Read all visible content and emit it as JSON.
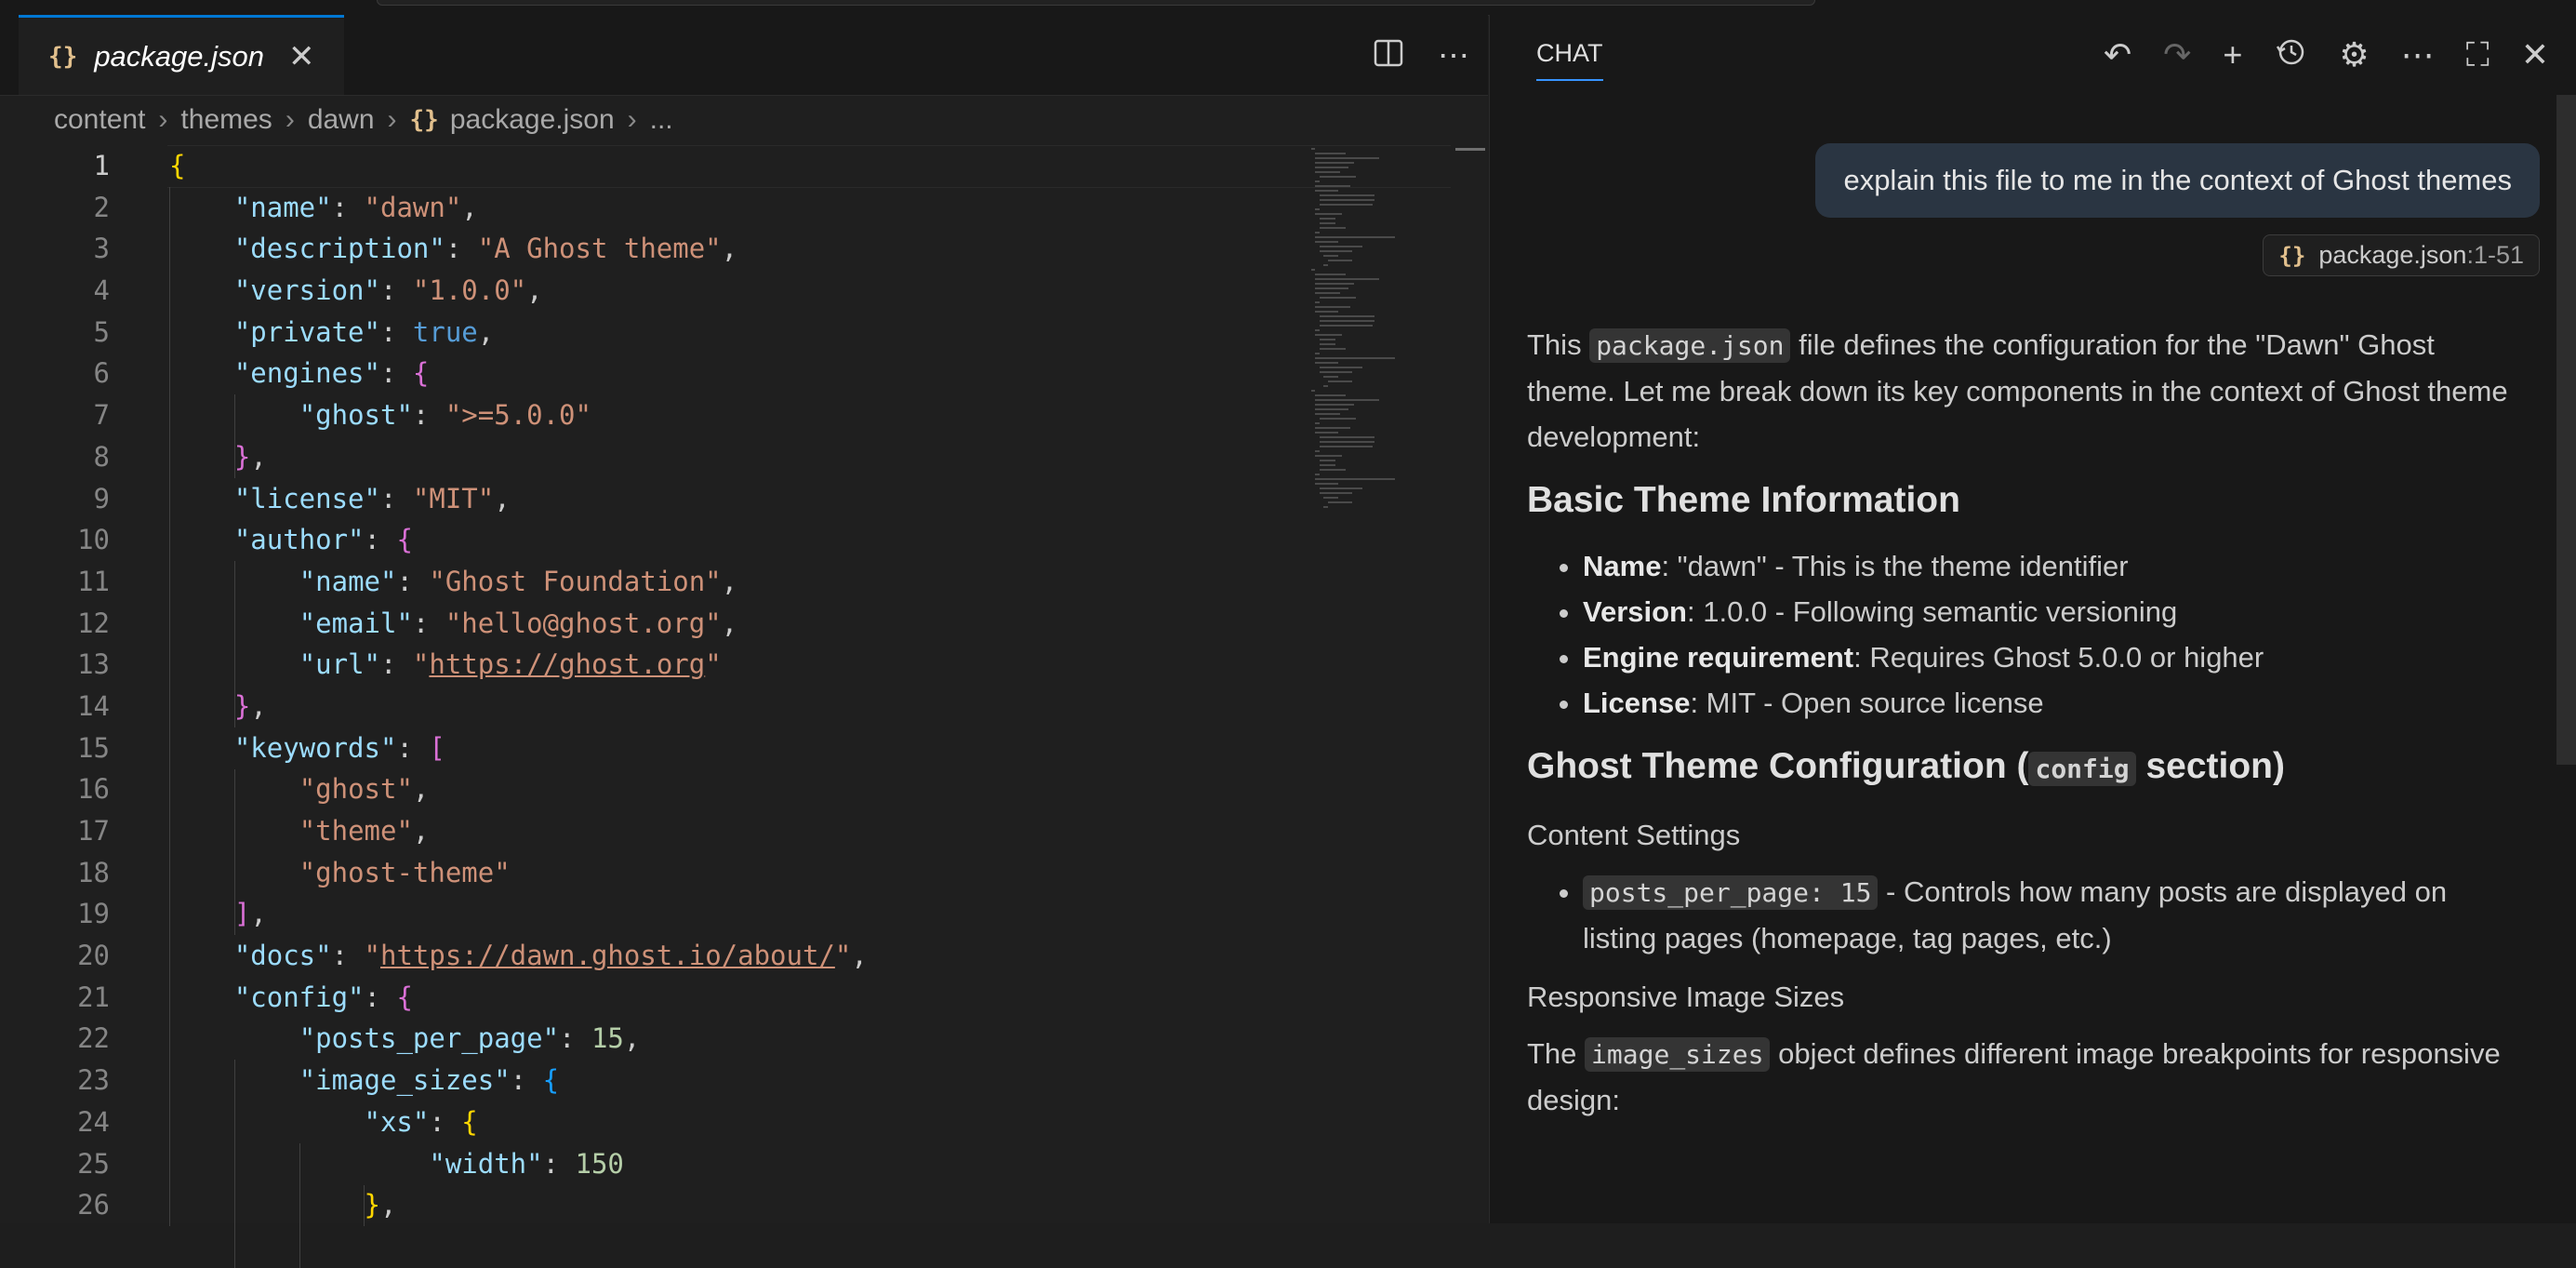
{
  "editor": {
    "tab": {
      "icon": "{}",
      "label": "package.json",
      "close": "✕"
    },
    "actions": {
      "split": "split-editor-icon",
      "more": "⋯"
    },
    "breadcrumb": [
      "content",
      "themes",
      "dawn",
      "package.json",
      "..."
    ],
    "breadcrumb_icon": "{}",
    "lines": [
      {
        "n": "1",
        "t": "{"
      },
      {
        "n": "2",
        "t": "    \"name\": \"dawn\","
      },
      {
        "n": "3",
        "t": "    \"description\": \"A Ghost theme\","
      },
      {
        "n": "4",
        "t": "    \"version\": \"1.0.0\","
      },
      {
        "n": "5",
        "t": "    \"private\": true,"
      },
      {
        "n": "6",
        "t": "    \"engines\": {"
      },
      {
        "n": "7",
        "t": "        \"ghost\": \">=5.0.0\""
      },
      {
        "n": "8",
        "t": "    },"
      },
      {
        "n": "9",
        "t": "    \"license\": \"MIT\","
      },
      {
        "n": "10",
        "t": "    \"author\": {"
      },
      {
        "n": "11",
        "t": "        \"name\": \"Ghost Foundation\","
      },
      {
        "n": "12",
        "t": "        \"email\": \"hello@ghost.org\","
      },
      {
        "n": "13",
        "t": "        \"url\": \"https://ghost.org\""
      },
      {
        "n": "14",
        "t": "    },"
      },
      {
        "n": "15",
        "t": "    \"keywords\": ["
      },
      {
        "n": "16",
        "t": "        \"ghost\","
      },
      {
        "n": "17",
        "t": "        \"theme\","
      },
      {
        "n": "18",
        "t": "        \"ghost-theme\""
      },
      {
        "n": "19",
        "t": "    ],"
      },
      {
        "n": "20",
        "t": "    \"docs\": \"https://dawn.ghost.io/about/\","
      },
      {
        "n": "21",
        "t": "    \"config\": {"
      },
      {
        "n": "22",
        "t": "        \"posts_per_page\": 15,"
      },
      {
        "n": "23",
        "t": "        \"image_sizes\": {"
      },
      {
        "n": "24",
        "t": "            \"xs\": {"
      },
      {
        "n": "25",
        "t": "                \"width\": 150"
      },
      {
        "n": "26",
        "t": "            },"
      }
    ]
  },
  "chat": {
    "title": "CHAT",
    "user_message": "explain this file to me in the context of Ghost themes",
    "reference": {
      "icon": "{}",
      "file": "package.json",
      "range": ":1-51"
    },
    "intro": {
      "before": "This ",
      "code": "package.json",
      "after": " file defines the configuration for the \"Dawn\" Ghost theme. Let me break down its key components in the context of Ghost theme development:"
    },
    "h_basic": "Basic Theme Information",
    "basic_items": [
      {
        "label": "Name",
        "text": ": \"dawn\" - This is the theme identifier"
      },
      {
        "label": "Version",
        "text": ": 1.0.0 - Following semantic versioning"
      },
      {
        "label": "Engine requirement",
        "text": ": Requires Ghost 5.0.0 or higher"
      },
      {
        "label": "License",
        "text": ": MIT - Open source license"
      }
    ],
    "h_config": {
      "before": "Ghost Theme Configuration (",
      "code": "config",
      "after": " section)"
    },
    "sub_content": "Content Settings",
    "content_item": {
      "code": "posts_per_page: 15",
      "text": " - Controls how many posts are displayed on listing pages (homepage, tag pages, etc.)"
    },
    "sub_images": "Responsive Image Sizes",
    "images_para": {
      "before": "The ",
      "code": "image_sizes",
      "after": " object defines different image breakpoints for responsive design:"
    }
  }
}
